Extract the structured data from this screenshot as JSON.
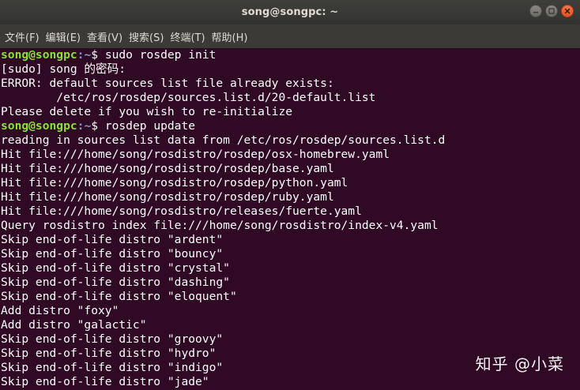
{
  "window": {
    "title": "song@songpc: ~"
  },
  "menubar": {
    "items": [
      {
        "label": "文件(F)"
      },
      {
        "label": "编辑(E)"
      },
      {
        "label": "查看(V)"
      },
      {
        "label": "搜索(S)"
      },
      {
        "label": "终端(T)"
      },
      {
        "label": "帮助(H)"
      }
    ]
  },
  "terminal": {
    "prompt_user": "song@songpc",
    "prompt_path": ":~",
    "prompt_symbol": "$",
    "lines": [
      {
        "type": "prompt",
        "command": " sudo rosdep init"
      },
      {
        "type": "output",
        "text": "[sudo] song 的密码:"
      },
      {
        "type": "output",
        "text": "ERROR: default sources list file already exists:"
      },
      {
        "type": "output",
        "text": "\t/etc/ros/rosdep/sources.list.d/20-default.list"
      },
      {
        "type": "output",
        "text": "Please delete if you wish to re-initialize"
      },
      {
        "type": "prompt",
        "command": " rosdep update"
      },
      {
        "type": "output",
        "text": "reading in sources list data from /etc/ros/rosdep/sources.list.d"
      },
      {
        "type": "output",
        "text": "Hit file:///home/song/rosdistro/rosdep/osx-homebrew.yaml"
      },
      {
        "type": "output",
        "text": "Hit file:///home/song/rosdistro/rosdep/base.yaml"
      },
      {
        "type": "output",
        "text": "Hit file:///home/song/rosdistro/rosdep/python.yaml"
      },
      {
        "type": "output",
        "text": "Hit file:///home/song/rosdistro/rosdep/ruby.yaml"
      },
      {
        "type": "output",
        "text": "Hit file:///home/song/rosdistro/releases/fuerte.yaml"
      },
      {
        "type": "output",
        "text": "Query rosdistro index file:///home/song/rosdistro/index-v4.yaml"
      },
      {
        "type": "output",
        "text": "Skip end-of-life distro \"ardent\""
      },
      {
        "type": "output",
        "text": "Skip end-of-life distro \"bouncy\""
      },
      {
        "type": "output",
        "text": "Skip end-of-life distro \"crystal\""
      },
      {
        "type": "output",
        "text": "Skip end-of-life distro \"dashing\""
      },
      {
        "type": "output",
        "text": "Skip end-of-life distro \"eloquent\""
      },
      {
        "type": "output",
        "text": "Add distro \"foxy\""
      },
      {
        "type": "output",
        "text": "Add distro \"galactic\""
      },
      {
        "type": "output",
        "text": "Skip end-of-life distro \"groovy\""
      },
      {
        "type": "output",
        "text": "Skip end-of-life distro \"hydro\""
      },
      {
        "type": "output",
        "text": "Skip end-of-life distro \"indigo\""
      },
      {
        "type": "output",
        "text": "Skip end-of-life distro \"jade\""
      }
    ]
  },
  "watermark": {
    "text": "知乎 @小菜"
  },
  "colors": {
    "terminal_bg": "#300a24",
    "prompt_user": "#8ae234",
    "prompt_path": "#729fcf",
    "titlebar_bg": "#3c3b37",
    "close_button": "#e95420"
  }
}
